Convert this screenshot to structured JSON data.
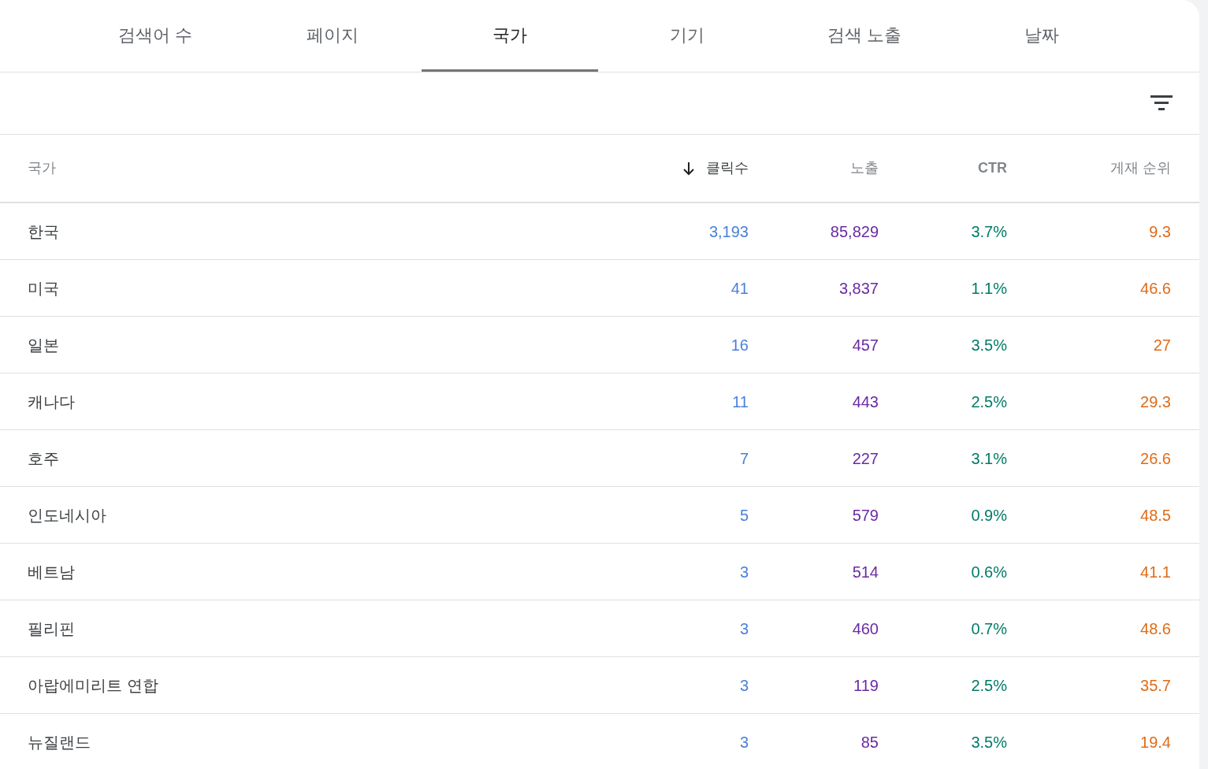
{
  "tabs": [
    {
      "label": "검색어 수",
      "selected": false
    },
    {
      "label": "페이지",
      "selected": false
    },
    {
      "label": "국가",
      "selected": true
    },
    {
      "label": "기기",
      "selected": false
    },
    {
      "label": "검색 노출",
      "selected": false
    },
    {
      "label": "날짜",
      "selected": false
    }
  ],
  "table": {
    "columns": [
      {
        "label": "국가",
        "kind": "name",
        "sorted": false
      },
      {
        "label": "클릭수",
        "kind": "clicks",
        "sorted": true
      },
      {
        "label": "노출",
        "kind": "impressions",
        "sorted": false
      },
      {
        "label": "CTR",
        "kind": "ctr",
        "sorted": false
      },
      {
        "label": "게재 순위",
        "kind": "position",
        "sorted": false
      }
    ],
    "rows": [
      [
        "한국",
        "3,193",
        "85,829",
        "3.7%",
        "9.3"
      ],
      [
        "미국",
        "41",
        "3,837",
        "1.1%",
        "46.6"
      ],
      [
        "일본",
        "16",
        "457",
        "3.5%",
        "27"
      ],
      [
        "캐나다",
        "11",
        "443",
        "2.5%",
        "29.3"
      ],
      [
        "호주",
        "7",
        "227",
        "3.1%",
        "26.6"
      ],
      [
        "인도네시아",
        "5",
        "579",
        "0.9%",
        "48.5"
      ],
      [
        "베트남",
        "3",
        "514",
        "0.6%",
        "41.1"
      ],
      [
        "필리핀",
        "3",
        "460",
        "0.7%",
        "48.6"
      ],
      [
        "아랍에미리트 연합",
        "3",
        "119",
        "2.5%",
        "35.7"
      ],
      [
        "뉴질랜드",
        "3",
        "85",
        "3.5%",
        "19.4"
      ]
    ]
  }
}
